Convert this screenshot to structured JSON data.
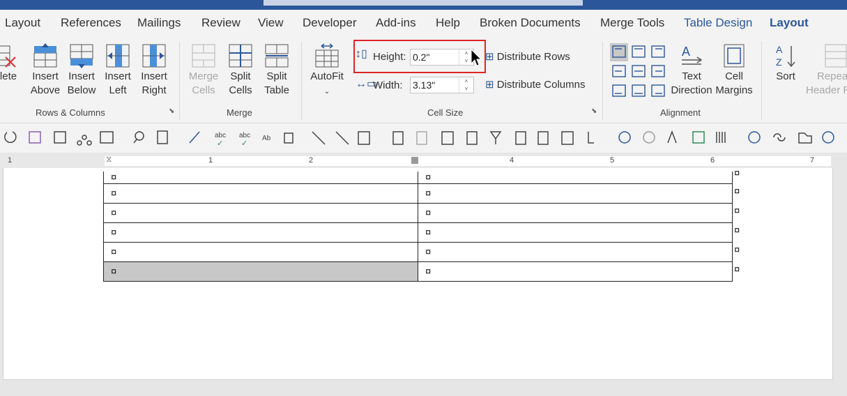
{
  "tabs": [
    "Layout",
    "References",
    "Mailings",
    "Review",
    "View",
    "Developer",
    "Add-ins",
    "Help",
    "Broken Documents",
    "Merge Tools",
    "Table Design",
    "Layout"
  ],
  "ribbon": {
    "rows_columns": {
      "delete_label": "lete",
      "insert_above": [
        "Insert",
        "Above"
      ],
      "insert_below": [
        "Insert",
        "Below"
      ],
      "insert_left": [
        "Insert",
        "Left"
      ],
      "insert_right": [
        "Insert",
        "Right"
      ],
      "group_label": "Rows & Columns"
    },
    "merge": {
      "merge_cells": [
        "Merge",
        "Cells"
      ],
      "split_cells": [
        "Split",
        "Cells"
      ],
      "split_table": [
        "Split",
        "Table"
      ],
      "group_label": "Merge"
    },
    "cell_size": {
      "autofit_label": "AutoFit",
      "height_label": "Height:",
      "height_value": "0.2\"",
      "width_label": "Width:",
      "width_value": "3.13\"",
      "distribute_rows": "Distribute Rows",
      "distribute_columns": "Distribute Columns",
      "group_label": "Cell Size"
    },
    "alignment": {
      "text_direction": [
        "Text",
        "Direction"
      ],
      "cell_margins": [
        "Cell",
        "Margins"
      ],
      "group_label": "Alignment"
    },
    "data": {
      "sort_label": "Sort",
      "repeat_header": [
        "Repea",
        "Header R"
      ]
    }
  },
  "ruler": {
    "numbers": [
      "1",
      "1",
      "2",
      "4",
      "5",
      "6",
      "7"
    ]
  },
  "document": {
    "cell_mark": "¤",
    "rows": 6
  },
  "colors": {
    "accent": "#2b579a",
    "highlight_border": "#e02424",
    "selected_cell": "#c8c8c8"
  }
}
